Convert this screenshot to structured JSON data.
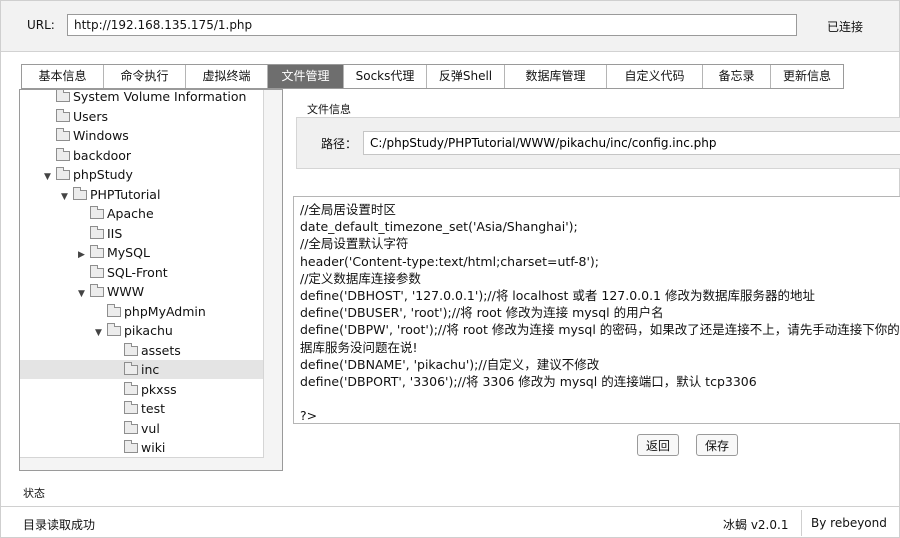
{
  "url_bar": {
    "label": "URL:",
    "value": "http://192.168.135.175/1.php",
    "status": "已连接"
  },
  "tabs": [
    {
      "label": "基本信息",
      "active": false
    },
    {
      "label": "命令执行",
      "active": false
    },
    {
      "label": "虚拟终端",
      "active": false
    },
    {
      "label": "文件管理",
      "active": true
    },
    {
      "label": "Socks代理",
      "active": false
    },
    {
      "label": "反弹Shell",
      "active": false
    },
    {
      "label": "数据库管理",
      "active": false
    },
    {
      "label": "自定义代码",
      "active": false
    },
    {
      "label": "备忘录",
      "active": false
    },
    {
      "label": "更新信息",
      "active": false
    }
  ],
  "tree": [
    {
      "label": "System Volume Information",
      "depth": 0,
      "toggle": "none"
    },
    {
      "label": "Users",
      "depth": 0,
      "toggle": "none"
    },
    {
      "label": "Windows",
      "depth": 0,
      "toggle": "none"
    },
    {
      "label": "backdoor",
      "depth": 0,
      "toggle": "none"
    },
    {
      "label": "phpStudy",
      "depth": 0,
      "toggle": "expanded"
    },
    {
      "label": "PHPTutorial",
      "depth": 1,
      "toggle": "expanded"
    },
    {
      "label": "Apache",
      "depth": 2,
      "toggle": "none"
    },
    {
      "label": "IIS",
      "depth": 2,
      "toggle": "none"
    },
    {
      "label": "MySQL",
      "depth": 2,
      "toggle": "collapsed"
    },
    {
      "label": "SQL-Front",
      "depth": 2,
      "toggle": "none"
    },
    {
      "label": "WWW",
      "depth": 2,
      "toggle": "expanded"
    },
    {
      "label": "phpMyAdmin",
      "depth": 3,
      "toggle": "none"
    },
    {
      "label": "pikachu",
      "depth": 3,
      "toggle": "expanded"
    },
    {
      "label": "assets",
      "depth": 4,
      "toggle": "none"
    },
    {
      "label": "inc",
      "depth": 4,
      "toggle": "none",
      "selected": true
    },
    {
      "label": "pkxss",
      "depth": 4,
      "toggle": "none"
    },
    {
      "label": "test",
      "depth": 4,
      "toggle": "none"
    },
    {
      "label": "vul",
      "depth": 4,
      "toggle": "none"
    },
    {
      "label": "wiki",
      "depth": 4,
      "toggle": "none"
    }
  ],
  "file_info": {
    "section_label": "文件信息",
    "path_label": "路径：",
    "path_value": "C:/phpStudy/PHPTutorial/WWW/pikachu/inc/config.inc.php"
  },
  "editor": {
    "lines": [
      "//全局居设置时区",
      "date_default_timezone_set('Asia/Shanghai');",
      "//全局设置默认字符",
      "header('Content-type:text/html;charset=utf-8');",
      "//定义数据库连接参数",
      "define('DBHOST', '127.0.0.1');//将 localhost 或者 127.0.0.1 修改为数据库服务器的地址",
      "define('DBUSER', 'root');//将 root 修改为连接 mysql 的用户名",
      "define('DBPW', 'root');//将 root 修改为连接 mysql 的密码，如果改了还是连接不上，请先手动连接下你的数据库，确保数据",
      "据库服务没问题在说!",
      "define('DBNAME', 'pikachu');//自定义，建议不修改",
      "define('DBPORT', '3306');//将 3306 修改为 mysql 的连接端口，默认 tcp3306",
      "",
      "?>"
    ]
  },
  "buttons": {
    "back": "返回",
    "save": "保存"
  },
  "status": {
    "label": "状态",
    "message": "目录读取成功",
    "version": "冰蝎 v2.0.1",
    "author": "By rebeyond"
  }
}
